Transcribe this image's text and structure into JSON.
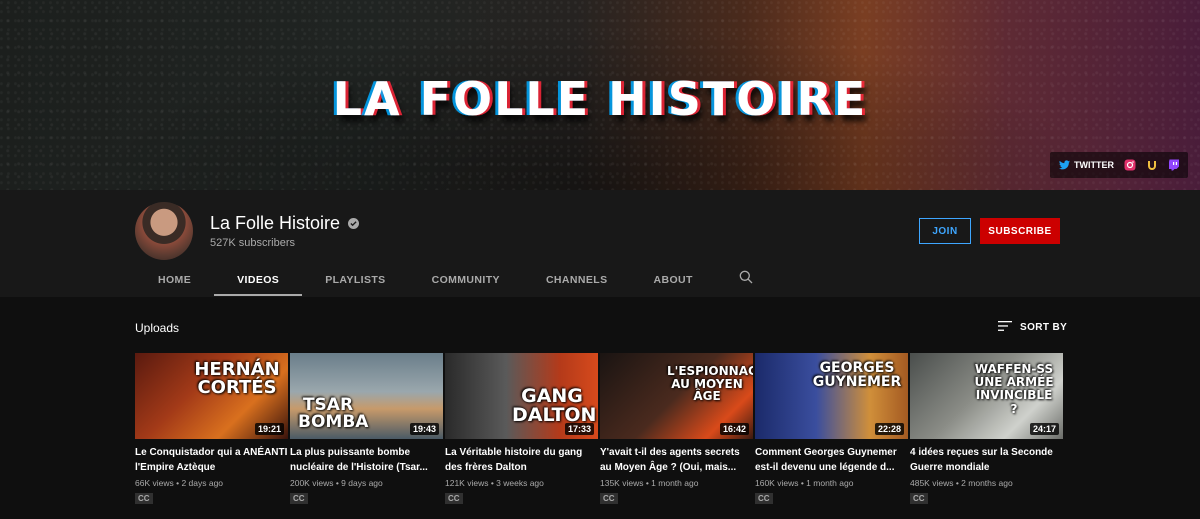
{
  "banner": {
    "title": "LA FOLLE HISTOIRE",
    "social": {
      "twitter_label": "TWITTER",
      "icons": [
        "twitter-icon",
        "instagram-icon",
        "utip-icon",
        "twitch-icon"
      ]
    }
  },
  "channel": {
    "name": "La Folle Histoire",
    "subscribers": "527K subscribers",
    "join_label": "JOIN",
    "subscribe_label": "SUBSCRIBE",
    "accent_color": "#cc0000",
    "join_color": "#3ea6ff"
  },
  "tabs": [
    {
      "label": "HOME",
      "active": false
    },
    {
      "label": "VIDEOS",
      "active": true
    },
    {
      "label": "PLAYLISTS",
      "active": false
    },
    {
      "label": "COMMUNITY",
      "active": false
    },
    {
      "label": "CHANNELS",
      "active": false
    },
    {
      "label": "ABOUT",
      "active": false
    }
  ],
  "uploads": {
    "title": "Uploads",
    "sort_label": "SORT BY",
    "videos": [
      {
        "thumb_text": "HERNÁN CORTÉS",
        "duration": "19:21",
        "title": "Le Conquistador qui a ANÉANTI l'Empire Aztèque",
        "meta": "66K views • 2 days ago",
        "badge": "CC"
      },
      {
        "thumb_text": "TSAR BOMBA",
        "duration": "19:43",
        "title": "La plus puissante bombe nucléaire de l'Histoire (Tsar...",
        "meta": "200K views • 9 days ago",
        "badge": "CC"
      },
      {
        "thumb_text": "GANG DALTON",
        "duration": "17:33",
        "title": "La Véritable histoire du gang des frères Dalton",
        "meta": "121K views • 3 weeks ago",
        "badge": "CC"
      },
      {
        "thumb_text": "L'ESPIONNAGE AU MOYEN ÂGE",
        "duration": "16:42",
        "title": "Y'avait t-il des agents secrets au Moyen Âge ? (Oui, mais...",
        "meta": "135K views • 1 month ago",
        "badge": "CC"
      },
      {
        "thumb_text": "GEORGES GUYNEMER",
        "duration": "22:28",
        "title": "Comment Georges Guynemer est-il devenu une légende d...",
        "meta": "160K views • 1 month ago",
        "badge": "CC"
      },
      {
        "thumb_text": "WAFFEN-SS UNE ARMÉE INVINCIBLE ?",
        "duration": "24:17",
        "title": "4 idées reçues sur la Seconde Guerre mondiale",
        "meta": "485K views • 2 months ago",
        "badge": "CC"
      }
    ]
  }
}
